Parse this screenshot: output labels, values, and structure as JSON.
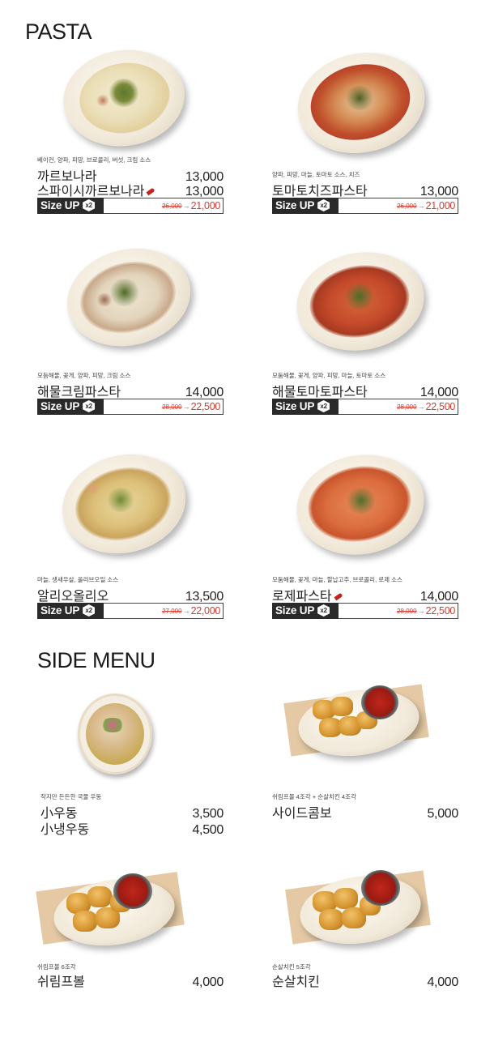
{
  "sections": {
    "pasta": {
      "title": "PASTA"
    },
    "side": {
      "title": "SIDE MENU"
    }
  },
  "size_up": {
    "label": "Size UP",
    "badge": "x2"
  },
  "pasta": [
    {
      "description": "베이컨, 양파, 피망, 브로콜리, 버섯, 크림 소스",
      "lines": [
        {
          "name": "까르보나라",
          "price": "13,000"
        },
        {
          "name": "스파이시까르보나라",
          "price": "13,000",
          "spicy": true
        }
      ],
      "size_up_old": "26,000",
      "size_up_new": "21,000"
    },
    {
      "description": "양파, 피망, 마늘, 토마토 소스, 치즈",
      "lines": [
        {
          "name": "토마토치즈파스타",
          "price": "13,000"
        }
      ],
      "size_up_old": "26,000",
      "size_up_new": "21,000"
    },
    {
      "description": "모듬해물, 꽃게, 양파, 피망, 크림 소스",
      "lines": [
        {
          "name": "해물크림파스타",
          "price": "14,000"
        }
      ],
      "size_up_old": "28,000",
      "size_up_new": "22,500"
    },
    {
      "description": "모둠해물, 꽃게, 양파, 피망, 마늘, 토마토 소스",
      "lines": [
        {
          "name": "해물토마토파스타",
          "price": "14,000"
        }
      ],
      "size_up_old": "28,000",
      "size_up_new": "22,500"
    },
    {
      "description": "마늘, 생새우살, 올리브오일 소스",
      "lines": [
        {
          "name": "알리오올리오",
          "price": "13,500"
        }
      ],
      "size_up_old": "27,000",
      "size_up_new": "22,000"
    },
    {
      "description": "모둠해물, 꽃게, 마늘, 할납고추, 브로콜리, 로제 소스",
      "lines": [
        {
          "name": "로제파스타",
          "price": "14,000",
          "spicy": true
        }
      ],
      "size_up_old": "28,000",
      "size_up_new": "22,500"
    }
  ],
  "side": [
    {
      "description": "작지만 든든한 국물 우동",
      "lines": [
        {
          "name": "小우동",
          "price": "3,500"
        },
        {
          "name": "小냉우동",
          "price": "4,500"
        }
      ]
    },
    {
      "description": "쉬림프볼 4조각 + 순살치킨 4조각",
      "lines": [
        {
          "name": "사이드콤보",
          "price": "5,000"
        }
      ]
    },
    {
      "description": "쉬림프볼 6조각",
      "lines": [
        {
          "name": "쉬림프볼",
          "price": "4,000"
        }
      ]
    },
    {
      "description": "순살치킨 5조각",
      "lines": [
        {
          "name": "순살치킨",
          "price": "4,000"
        }
      ]
    }
  ],
  "colors": {
    "price_accent": "#d8392c",
    "badge_bg": "#2a2a2a",
    "spicy": "#c8231a"
  },
  "icons": [
    "chili-pepper-icon",
    "x2-badge-icon"
  ]
}
